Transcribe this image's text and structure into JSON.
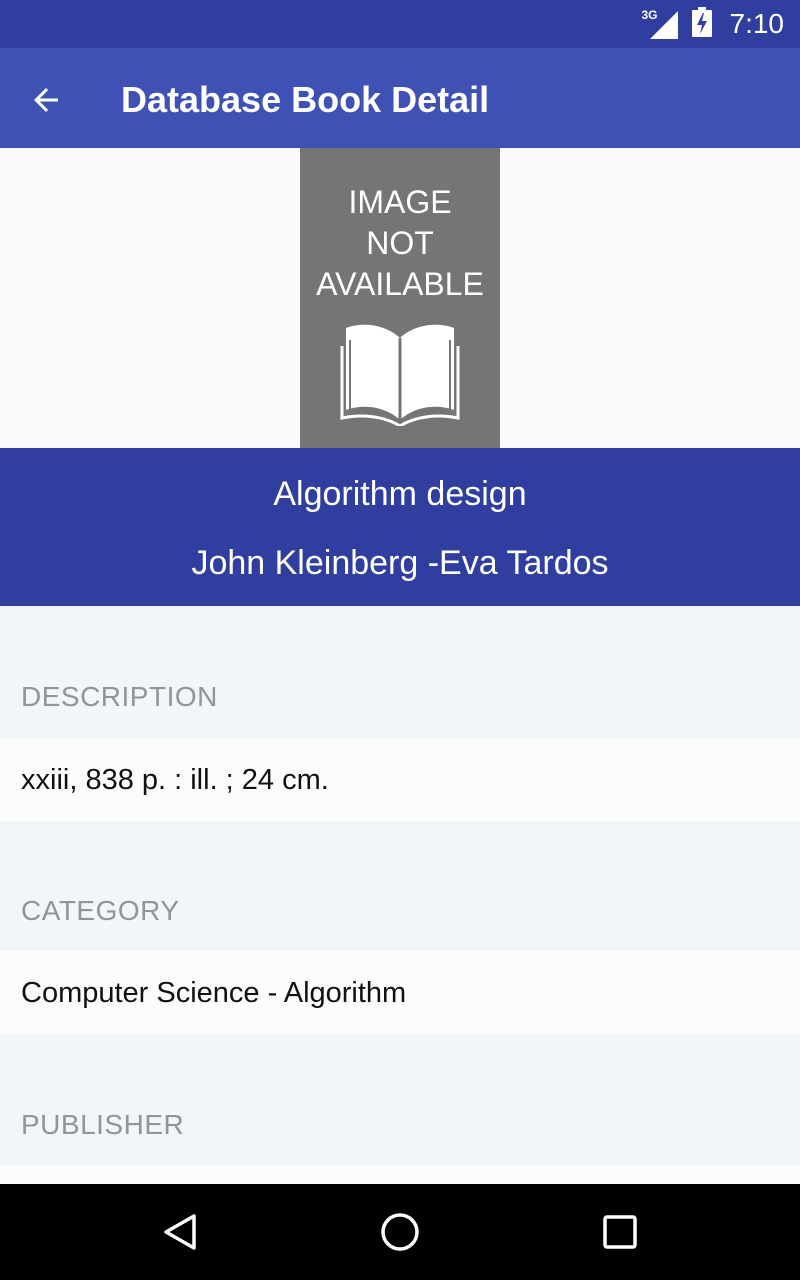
{
  "status_bar": {
    "network_type": "3G",
    "time": "7:10",
    "icons": [
      "signal-3g-icon",
      "battery-charging-icon"
    ]
  },
  "app_bar": {
    "title": "Database Book Detail",
    "back_icon": "arrow-back-icon"
  },
  "cover": {
    "placeholder_text": [
      "IMAGE",
      "NOT",
      "AVAILABLE"
    ],
    "icon": "open-book-icon"
  },
  "book": {
    "title": "Algorithm design",
    "authors": "John Kleinberg -Eva Tardos"
  },
  "details": {
    "description": {
      "label": "DESCRIPTION",
      "value": "xxiii, 838 p. : ill. ; 24 cm."
    },
    "category": {
      "label": "CATEGORY",
      "value": "Computer Science - Algorithm"
    },
    "publisher": {
      "label": "PUBLISHER",
      "value": ""
    }
  },
  "nav_bar": {
    "icons": [
      "back-triangle-icon",
      "home-circle-icon",
      "recents-square-icon"
    ]
  },
  "colors": {
    "primary": "#3f51b5",
    "primary_dark": "#303f9f",
    "cover_gray": "#757575",
    "background": "#f3f6f9"
  }
}
